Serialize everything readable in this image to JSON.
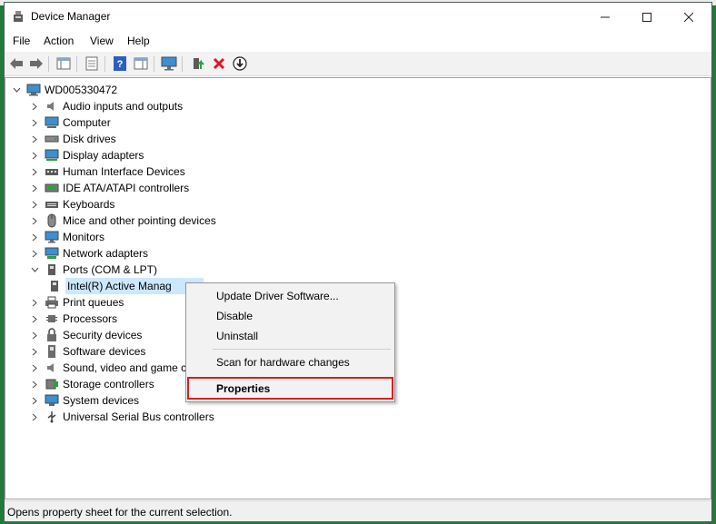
{
  "window": {
    "title": "Device Manager"
  },
  "menu": {
    "file": "File",
    "action": "Action",
    "view": "View",
    "help": "Help"
  },
  "tree": {
    "root": "WD005330472",
    "categories": [
      "Audio inputs and outputs",
      "Computer",
      "Disk drives",
      "Display adapters",
      "Human Interface Devices",
      "IDE ATA/ATAPI controllers",
      "Keyboards",
      "Mice and other pointing devices",
      "Monitors",
      "Network adapters",
      "Ports (COM & LPT)",
      "Print queues",
      "Processors",
      "Security devices",
      "Software devices",
      "Sound, video and game c",
      "Storage controllers",
      "System devices",
      "Universal Serial Bus controllers"
    ],
    "selected_child": "Intel(R) Active Manag"
  },
  "context_menu": {
    "update_driver": "Update Driver Software...",
    "disable": "Disable",
    "uninstall": "Uninstall",
    "scan": "Scan for hardware changes",
    "properties": "Properties"
  },
  "status": {
    "text": "Opens property sheet for the current selection."
  },
  "colors": {
    "selection": "#cce8ff",
    "highlight_border": "#d6201e",
    "uninstall_icon": "#e81123"
  }
}
